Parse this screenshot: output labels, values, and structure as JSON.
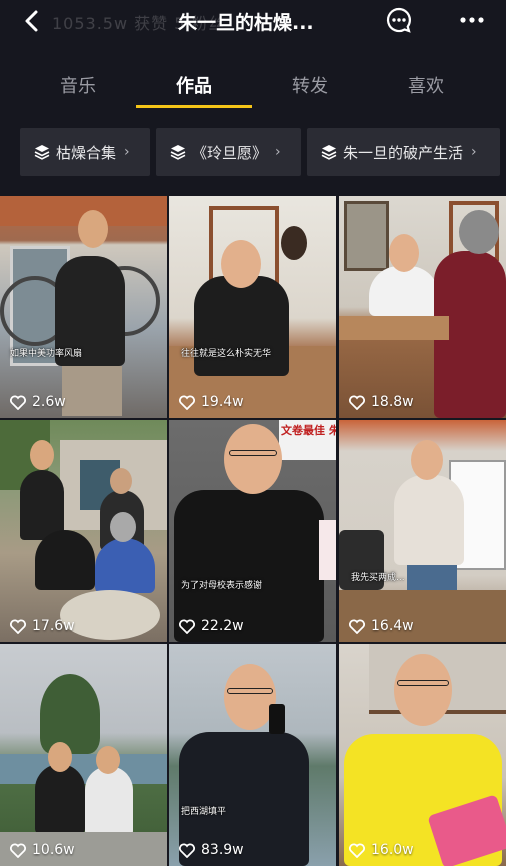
{
  "header": {
    "title": "朱一旦的枯燥...",
    "background_stats_text": "1053.5w 获赞    5            粉丝",
    "back_icon": "back-arrow-icon",
    "message_icon": "message-icon",
    "more_icon": "more-icon"
  },
  "tabs": [
    {
      "label": "音乐",
      "active": false
    },
    {
      "label": "作品",
      "active": true
    },
    {
      "label": "转发",
      "active": false
    },
    {
      "label": "喜欢",
      "active": false
    }
  ],
  "collections": [
    {
      "label": "枯燥合集",
      "icon": "stack-icon"
    },
    {
      "label": "《玲旦愿》",
      "icon": "stack-icon"
    },
    {
      "label": "朱一旦的破产生活",
      "icon": "stack-icon"
    }
  ],
  "videos": [
    {
      "likes": "2.6w",
      "caption": "如果中美功率风扇"
    },
    {
      "likes": "19.4w",
      "caption": "往往就是这么朴实无华"
    },
    {
      "likes": "18.8w",
      "caption": ""
    },
    {
      "likes": "17.6w",
      "caption": ""
    },
    {
      "likes": "22.2w",
      "caption": "为了对母校表示感谢",
      "sign_text": "文卷最佳 朱一"
    },
    {
      "likes": "16.4w",
      "caption": "我先买两成..."
    },
    {
      "likes": "10.6w",
      "caption": ""
    },
    {
      "likes": "83.9w",
      "caption": "把西湖填平"
    },
    {
      "likes": "16.0w",
      "caption": ""
    }
  ],
  "colors": {
    "background": "#16171f",
    "tab_indicator": "#f5c518",
    "collection_bg": "#2b2c34"
  }
}
